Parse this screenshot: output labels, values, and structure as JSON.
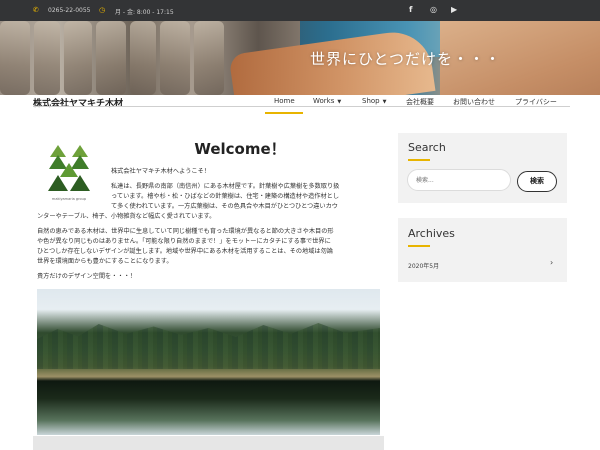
{
  "topbar": {
    "phone": "0265-22-0055",
    "hours": "月 - 金: 8:00 - 17:15",
    "phone_icon": "phone-icon",
    "clock_icon": "clock-icon",
    "social": [
      "facebook-icon",
      "instagram-icon",
      "youtube-icon"
    ],
    "accent_color": "#e8b400"
  },
  "banner": {
    "text": "世界にひとつだけを・・・"
  },
  "header": {
    "site_title": "株式会社ヤマキチ木材",
    "nav": [
      {
        "label": "Home"
      },
      {
        "label": "Works"
      },
      {
        "label": "Shop"
      },
      {
        "label": "会社概要"
      },
      {
        "label": "お問い合わせ"
      },
      {
        "label": "プライバシー"
      }
    ]
  },
  "main": {
    "heading": "Welcome！",
    "logo_caption": "makiyamaria group",
    "p1": "株式会社ヤマキチ木材へようこそ！",
    "p2_lines": [
      "私達は、長野県の南部（南信州）にある木材屋です。針葉樹や広葉樹を多数取り扱",
      "っています。檜や杉・松・ひばなどの針葉樹は、住宅・建築の構造材や造作材とし",
      "て多く使われています。一方広葉樹は、その色具合や木目がひとつひとつ違いカウ",
      "ンターやテーブル、椅子、小物雑貨など幅広く愛されています。"
    ],
    "p3_lines": [
      "自然の恵みである木材は、世界中に生息していて同じ樹種でも育った環境が異なると節の大きさや木目の形",
      "や色が異なり同じものはありません。「可能な限り自然のままで！」をモットーにカタチにする事で世界に",
      "ひとつしか存在しないデザインが誕生します。地域や世界中にある木材を活用することは、その地域は勿論",
      "世界を環境面からも豊かにすることになります。"
    ],
    "p4": "貴方だけのデザイン空間を・・・！"
  },
  "sidebar": {
    "search_title": "Search",
    "search_placeholder": "検索...",
    "search_button": "検索",
    "archives_title": "Archives",
    "archive_item": "2020年5月"
  }
}
